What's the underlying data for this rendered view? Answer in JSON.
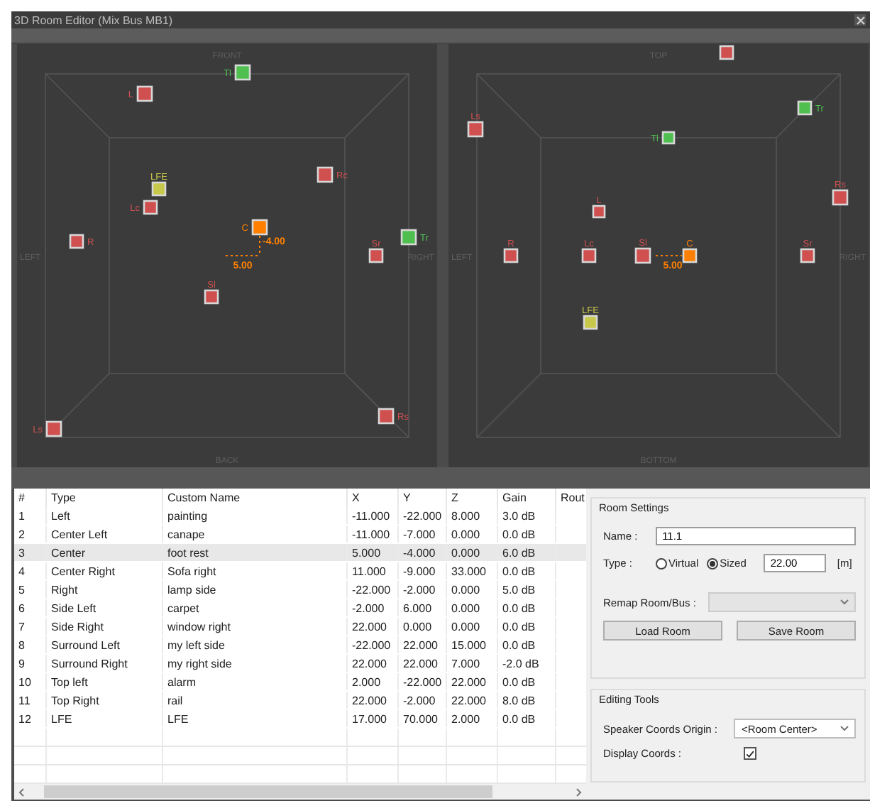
{
  "window": {
    "title": "3D Room Editor (Mix Bus MB1)"
  },
  "views": [
    {
      "labels": {
        "top": "FRONT",
        "bottom": "BACK",
        "left": "LEFT",
        "right": "RIGHT"
      },
      "speakers": [
        {
          "label": "Tl",
          "color": "#4fc04f"
        },
        {
          "label": "L",
          "color": "#d05050"
        },
        {
          "label": "Rc",
          "color": "#d05050"
        },
        {
          "label": "LFE",
          "color": "#c8c84a"
        },
        {
          "label": "Lc",
          "color": "#d05050"
        },
        {
          "label": "C",
          "color": "#ff8000",
          "coords": [
            {
              "kind": "vertical",
              "value": "-4.00"
            },
            {
              "kind": "horizontal",
              "value": "5.00"
            }
          ]
        },
        {
          "label": "Tr",
          "color": "#4fc04f"
        },
        {
          "label": "R",
          "color": "#d05050"
        },
        {
          "label": "Sr",
          "color": "#d05050"
        },
        {
          "label": "Sl",
          "color": "#d05050"
        },
        {
          "label": "Rs",
          "color": "#d05050"
        },
        {
          "label": "Ls",
          "color": "#d05050"
        }
      ]
    },
    {
      "labels": {
        "top": "TOP",
        "bottom": "BOTTOM",
        "left": "LEFT",
        "right": "RIGHT"
      },
      "speakers": [
        {
          "color": "#d05050"
        },
        {
          "label": "Tr",
          "color": "#4fc04f"
        },
        {
          "label": "Ls",
          "color": "#d05050"
        },
        {
          "label": "Tl",
          "color": "#4fc04f"
        },
        {
          "label": "Rs",
          "color": "#d05050"
        },
        {
          "label": "L",
          "color": "#d05050"
        },
        {
          "label": "R",
          "color": "#d05050"
        },
        {
          "label": "Lc",
          "color": "#d05050"
        },
        {
          "label": "Sl",
          "color": "#d05050"
        },
        {
          "label": "C",
          "color": "#ff8000",
          "coords": [
            {
              "kind": "horizontal",
              "value": "5.00"
            }
          ]
        },
        {
          "label": "Sr",
          "color": "#d05050"
        },
        {
          "label": "LFE",
          "color": "#c8c84a"
        }
      ]
    }
  ],
  "table": {
    "columns": [
      "#",
      "Type",
      "Custom Name",
      "X",
      "Y",
      "Z",
      "Gain",
      "Rout"
    ],
    "rows": [
      {
        "cells": [
          "1",
          "Left",
          "painting",
          "-11.000",
          "-22.000",
          "8.000",
          "3.0 dB"
        ],
        "selected": false
      },
      {
        "cells": [
          "2",
          "Center Left",
          "canape",
          "-11.000",
          "-7.000",
          "0.000",
          "0.0 dB"
        ],
        "selected": false
      },
      {
        "cells": [
          "3",
          "Center",
          "foot rest",
          "5.000",
          "-4.000",
          "0.000",
          "6.0 dB"
        ],
        "selected": true
      },
      {
        "cells": [
          "4",
          "Center Right",
          "Sofa right",
          "11.000",
          "-9.000",
          "33.000",
          "0.0 dB"
        ],
        "selected": false
      },
      {
        "cells": [
          "5",
          "Right",
          "lamp side",
          "-22.000",
          "-2.000",
          "0.000",
          "5.0 dB"
        ],
        "selected": false
      },
      {
        "cells": [
          "6",
          "Side Left",
          "carpet",
          "-2.000",
          "6.000",
          "0.000",
          "0.0 dB"
        ],
        "selected": false
      },
      {
        "cells": [
          "7",
          "Side Right",
          "window right",
          "22.000",
          "0.000",
          "0.000",
          "0.0 dB"
        ],
        "selected": false
      },
      {
        "cells": [
          "8",
          "Surround Left",
          "my left side",
          "-22.000",
          "22.000",
          "15.000",
          "0.0 dB"
        ],
        "selected": false
      },
      {
        "cells": [
          "9",
          "Surround Right",
          "my right side",
          "22.000",
          "22.000",
          "7.000",
          "-2.0 dB"
        ],
        "selected": false
      },
      {
        "cells": [
          "10",
          "Top left",
          "alarm",
          "2.000",
          "-22.000",
          "22.000",
          "0.0 dB"
        ],
        "selected": false
      },
      {
        "cells": [
          "11",
          "Top Right",
          "rail",
          "22.000",
          "-2.000",
          "22.000",
          "8.0 dB"
        ],
        "selected": false
      },
      {
        "cells": [
          "12",
          "LFE",
          "LFE",
          "17.000",
          "70.000",
          "2.000",
          "0.0 dB"
        ],
        "selected": false
      }
    ]
  },
  "room_settings": {
    "title": "Room Settings",
    "name_label": "Name :",
    "name_value": "11.1",
    "type_label": "Type :",
    "type_options": [
      {
        "label": "Virtual",
        "selected": false
      },
      {
        "label": "Sized",
        "selected": true
      }
    ],
    "size_value": "22.00",
    "size_unit": "[m]",
    "remap_label": "Remap Room/Bus :",
    "remap_disabled": true,
    "buttons": [
      "Load Room",
      "Save Room"
    ]
  },
  "editing_tools": {
    "title": "Editing Tools",
    "origin_label": "Speaker Coords Origin :",
    "origin_value": "<Room Center>",
    "display_coords_label": "Display Coords :",
    "display_coords_checked": true
  }
}
